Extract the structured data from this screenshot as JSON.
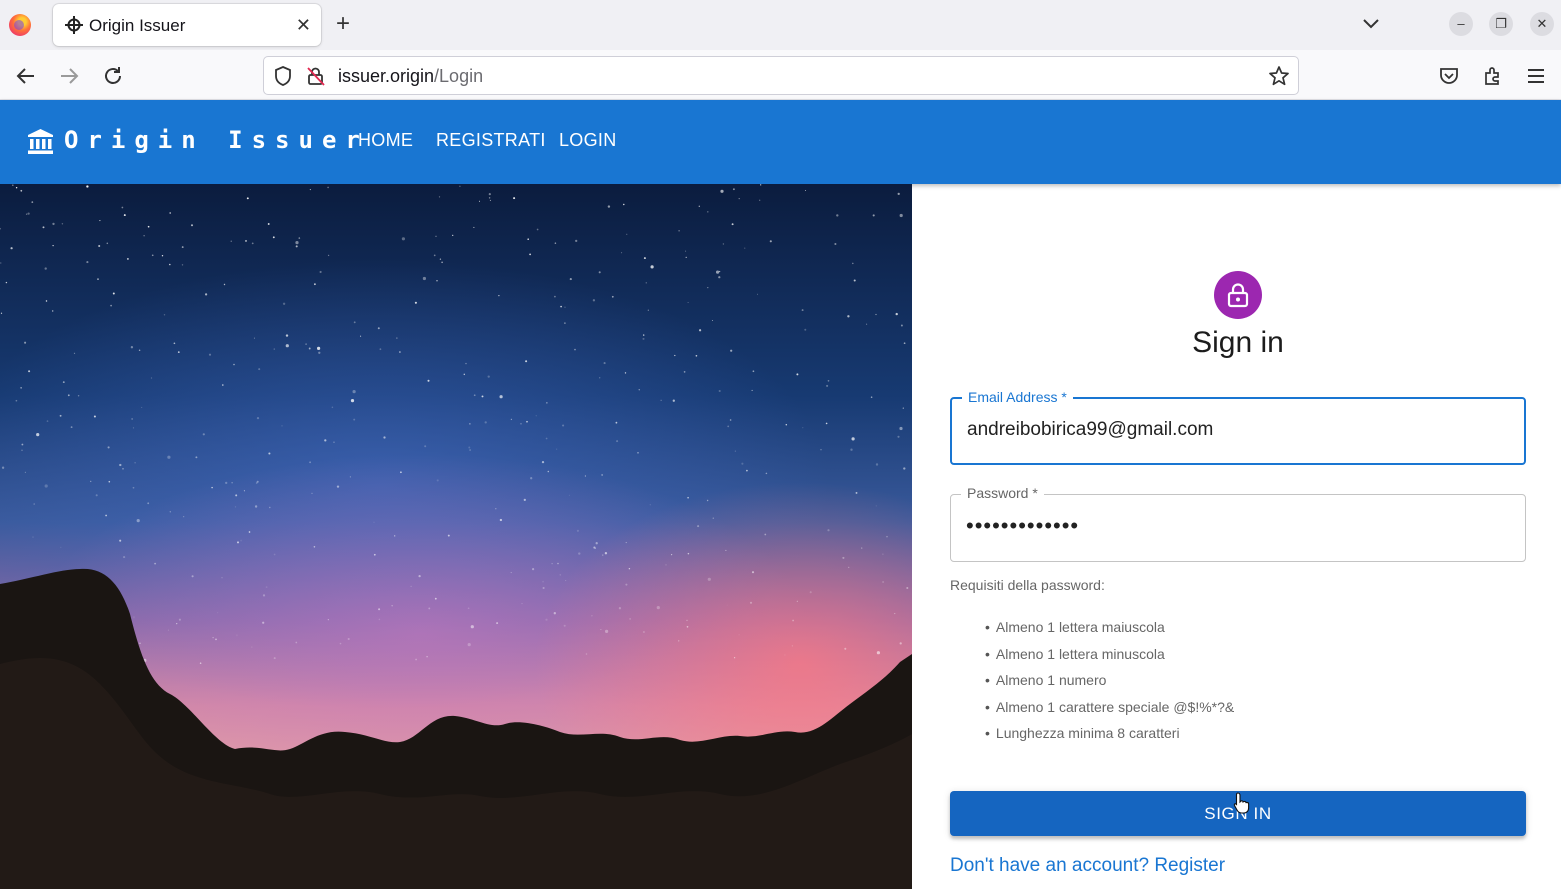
{
  "browser": {
    "tab_title": "Origin Issuer",
    "tab_close": "✕",
    "new_tab": "+",
    "url_host": "issuer.origin",
    "url_path": "/Login",
    "window_buttons": [
      "–",
      "❐",
      "✕"
    ]
  },
  "header": {
    "brand": "Origin Issuer",
    "nav": [
      "HOME",
      "REGISTRATI",
      "LOGIN"
    ],
    "color": "#1976d2"
  },
  "signin": {
    "title": "Sign in",
    "email_label": "Email Address *",
    "email_value": "andreibobirica99@gmail.com",
    "password_label": "Password *",
    "password_value": "•••••••••••••",
    "requirements_title": "Requisiti della password:",
    "requirements": [
      "Almeno 1 lettera maiuscola",
      "Almeno 1 lettera minuscola",
      "Almeno 1 numero",
      "Almeno 1 carattere speciale @$!%*?&",
      "Lunghezza minima 8 caratteri"
    ],
    "button": "SIGN IN",
    "register_link": "Don't have an account? Register",
    "avatar_color": "#9c27b0"
  },
  "icons": {
    "brand": "bank-icon",
    "avatar": "lock-icon"
  }
}
